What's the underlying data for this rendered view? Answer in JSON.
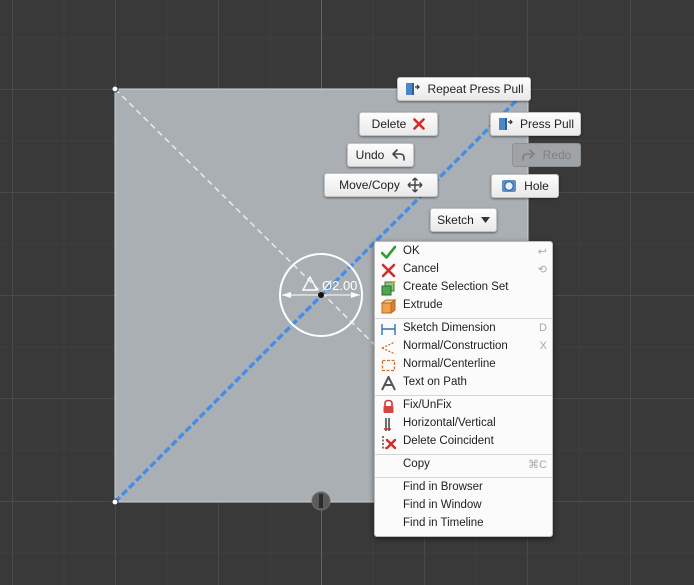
{
  "dimension": {
    "value": "Ø2.00"
  },
  "marking_menu": {
    "repeat_press_pull": "Repeat Press Pull",
    "press_pull": "Press Pull",
    "delete": "Delete",
    "undo": "Undo",
    "redo": "Redo",
    "move_copy": "Move/Copy",
    "hole": "Hole",
    "sketch": "Sketch"
  },
  "context_menu": {
    "items": [
      {
        "label": "OK",
        "shortcut": "↩",
        "icon": "checkmark-icon"
      },
      {
        "label": "Cancel",
        "shortcut": "⟲",
        "icon": "red-x-icon"
      },
      {
        "label": "Create Selection Set",
        "shortcut": "",
        "icon": "selection-set-icon"
      },
      {
        "label": "Extrude",
        "shortcut": "",
        "icon": "extrude-icon"
      },
      {
        "label": "Sketch Dimension",
        "shortcut": "D",
        "icon": "sketch-dimension-icon"
      },
      {
        "label": "Normal/Construction",
        "shortcut": "X",
        "icon": "construction-icon"
      },
      {
        "label": "Normal/Centerline",
        "shortcut": "",
        "icon": "centerline-icon"
      },
      {
        "label": "Text on Path",
        "shortcut": "",
        "icon": "text-icon"
      },
      {
        "label": "Fix/UnFix",
        "shortcut": "",
        "icon": "lock-icon"
      },
      {
        "label": "Horizontal/Vertical",
        "shortcut": "",
        "icon": "horizontal-vertical-icon"
      },
      {
        "label": "Delete Coincident",
        "shortcut": "",
        "icon": "delete-coincident-icon"
      },
      {
        "label": "Copy",
        "shortcut": "⌘C",
        "icon": ""
      },
      {
        "label": "Find in Browser",
        "shortcut": "",
        "icon": ""
      },
      {
        "label": "Find in Window",
        "shortcut": "",
        "icon": ""
      },
      {
        "label": "Find in Timeline",
        "shortcut": "",
        "icon": ""
      }
    ]
  }
}
